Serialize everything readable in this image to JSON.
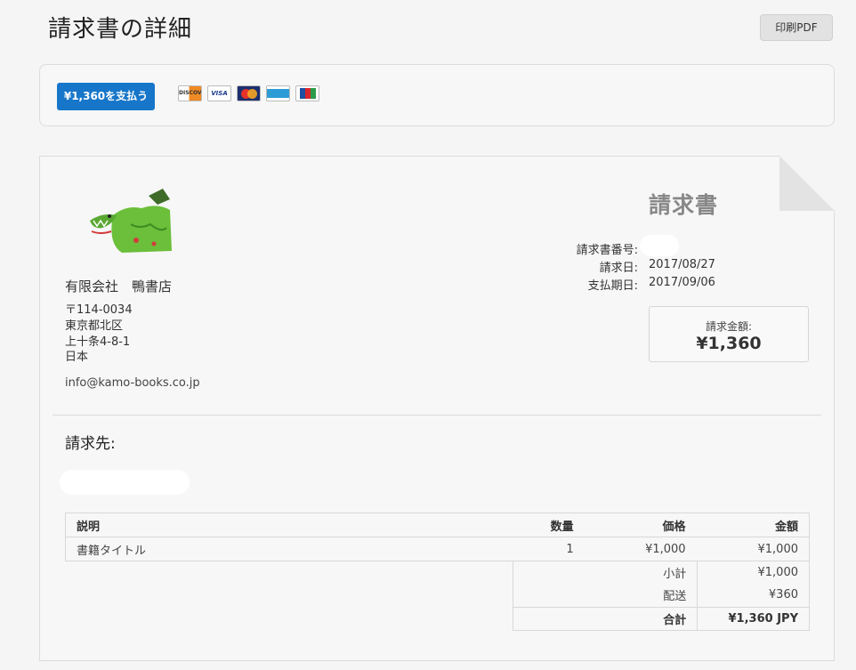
{
  "header": {
    "title": "請求書の詳細",
    "print_label": "印刷PDF"
  },
  "payment": {
    "pay_button_label": "¥1,360を支払う",
    "card_icons": [
      "discover-icon",
      "visa-icon",
      "mastercard-icon",
      "amex-icon",
      "jcb-icon"
    ],
    "card_labels": {
      "discover": "DISCOVER",
      "visa": "VISA",
      "jcb": "JCB"
    },
    "accent_color": "#1776c9"
  },
  "invoice": {
    "doc_title": "請求書",
    "seller": {
      "name": "有限会社　鴨書店",
      "address_lines": [
        "〒114-0034",
        "東京都北区",
        "上十条4-8-1",
        "日本"
      ],
      "email": "info@kamo-books.co.jp"
    },
    "meta": {
      "number_label": "請求書番号:",
      "date_label": "請求日:",
      "date_value": "2017/08/27",
      "due_label": "支払期日:",
      "due_value": "2017/09/06"
    },
    "amount_due": {
      "label": "請求金額:",
      "value": "¥1,360"
    },
    "bill_to_label": "請求先:",
    "table": {
      "headers": [
        "説明",
        "数量",
        "価格",
        "金額"
      ],
      "rows": [
        [
          "書籍タイトル",
          "1",
          "¥1,000",
          "¥1,000"
        ]
      ]
    },
    "totals": {
      "subtotal_label": "小計",
      "subtotal_value": "¥1,000",
      "shipping_label": "配送",
      "shipping_value": "¥360",
      "total_label": "合計",
      "total_value": "¥1,360 JPY"
    }
  }
}
